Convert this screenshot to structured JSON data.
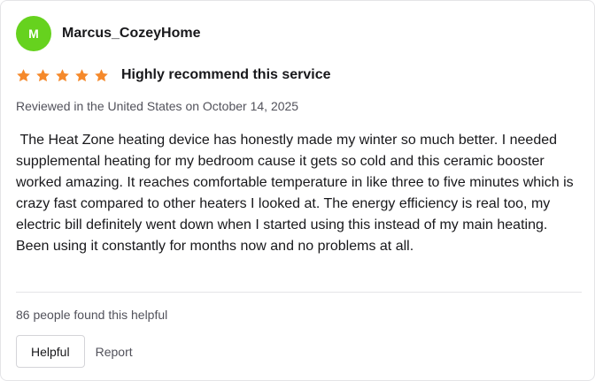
{
  "reviewer": {
    "avatar_initial": "M",
    "avatar_color": "#66d21e",
    "name": "Marcus_CozeyHome"
  },
  "rating": {
    "stars": 5,
    "max_stars": 5,
    "star_color": "#f5892b",
    "star_icon": "star-icon"
  },
  "review": {
    "title": "Highly recommend this service",
    "meta": "Reviewed in the United States on October 14, 2025",
    "body": " The Heat Zone heating device has honestly made my winter so much better. I needed supplemental heating for my bedroom cause it gets so cold and this ceramic booster worked amazing. It reaches comfortable temperature in like three to five minutes which is crazy fast compared to other heaters I looked at. The energy efficiency is real too, my electric bill definitely went down when I started using this instead of my main heating. Been using it constantly for months now and no problems at all."
  },
  "footer": {
    "helpful_count_text": "86 people found this helpful",
    "helpful_label": "Helpful",
    "report_label": "Report"
  }
}
